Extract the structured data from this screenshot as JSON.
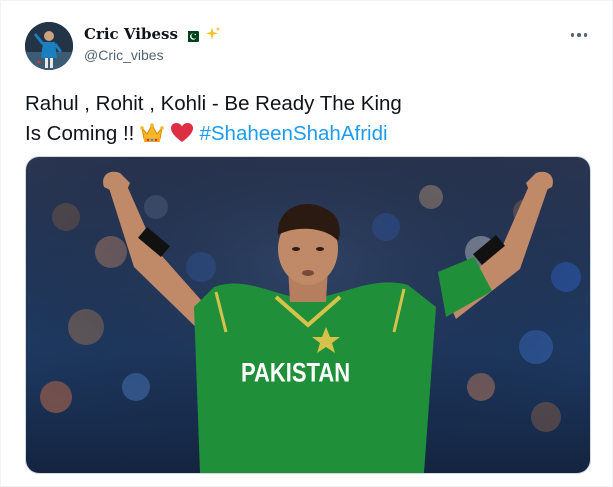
{
  "author": {
    "display_name": "Cric Vibess",
    "handle": "@Cric_vibes"
  },
  "tweet": {
    "text_line1": "Rahul , Rohit , Kohli - Be Ready The King",
    "text_line2_prefix": "Is Coming !! ",
    "hashtag": "#ShaheenShahAfridi"
  },
  "media": {
    "jersey_text": "PAKISTAN"
  },
  "colors": {
    "hashtag": "#1d9bf0",
    "jersey": "#1f8f3a",
    "heart": "#e0245e"
  },
  "icons": [
    "avatar",
    "flag-icon",
    "sparkle-icon",
    "more-icon",
    "crown-emoji",
    "heart-emoji"
  ]
}
